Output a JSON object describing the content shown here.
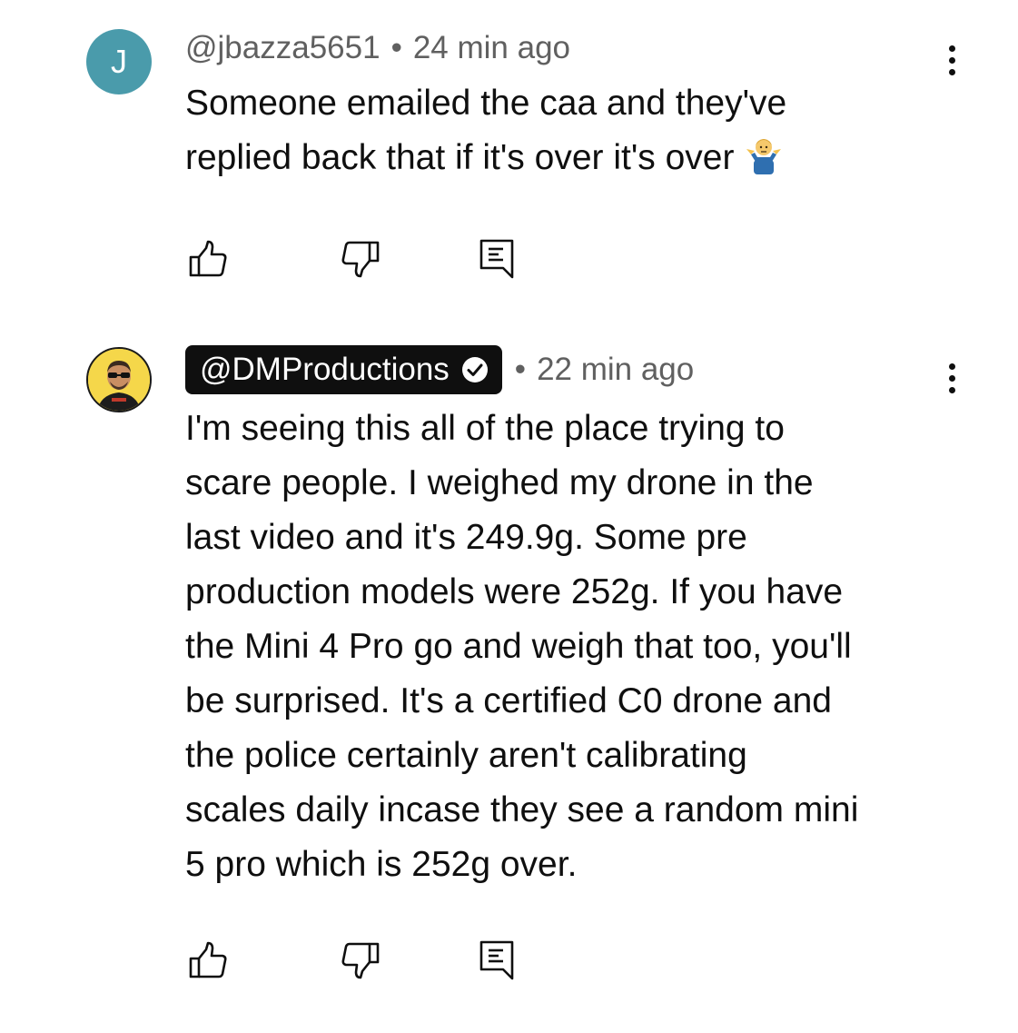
{
  "comments": [
    {
      "avatar_letter": "J",
      "avatar_color": "#4a9bab",
      "handle": "@jbazza5651",
      "separator": "•",
      "time": "24 min ago",
      "text": "Someone emailed the caa and they've\nreplied back that if it's over it's over",
      "emoji_icon": "person-shrugging-icon",
      "actions": {
        "like_icon": "thumbs-up-icon",
        "dislike_icon": "thumbs-down-icon",
        "reply_icon": "reply-comment-icon"
      },
      "menu_icon": "more-vertical-icon"
    },
    {
      "avatar_kind": "photo",
      "avatar_color": "#f5d74a",
      "handle": "@DMProductions",
      "verified": true,
      "separator": "•",
      "time": "22 min ago",
      "text": "I'm seeing this all of the place trying to\nscare people. I weighed my drone in the\nlast video and it's 249.9g.  Some pre\nproduction models were 252g.  If you have\nthe Mini 4 Pro go and weigh that too, you'll\nbe surprised.  It's a certified C0 drone and\nthe police certainly aren't calibrating\nscales daily incase they see a random mini\n5 pro which is 252g over.",
      "actions": {
        "like_icon": "thumbs-up-icon",
        "dislike_icon": "thumbs-down-icon",
        "reply_icon": "reply-comment-icon"
      },
      "menu_icon": "more-vertical-icon"
    }
  ]
}
